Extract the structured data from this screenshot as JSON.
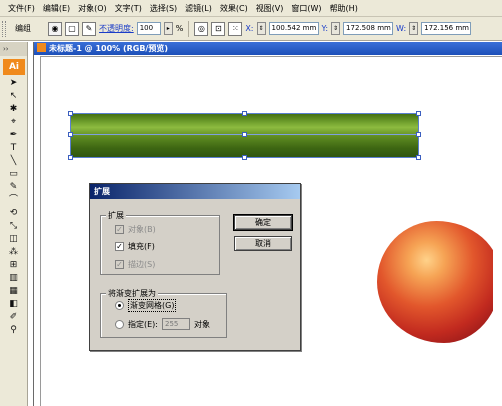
{
  "menu": [
    "文件(F)",
    "编辑(E)",
    "对象(O)",
    "文字(T)",
    "选择(S)",
    "滤镜(L)",
    "效果(C)",
    "视图(V)",
    "窗口(W)",
    "帮助(H)"
  ],
  "controlbar": {
    "selection_label": "编组",
    "opacity_label": "不透明度:",
    "opacity_value": "100",
    "opacity_unit": "%",
    "x_label": "X:",
    "x_value": "100.542 mm",
    "y_label": "Y:",
    "y_value": "172.508 mm",
    "w_label": "W:",
    "w_value": "172.156 mm"
  },
  "toolbar": {
    "header": "››",
    "logo": "Ai",
    "tools": [
      "➤",
      "↖",
      "✱",
      "⌖",
      "✒",
      "T",
      "╲",
      "▭",
      "✎",
      "⌒",
      "⟲",
      "⤡",
      "◫",
      "⁂",
      "⊞",
      "▥",
      "▦",
      "◧",
      "✐",
      "⚲"
    ]
  },
  "document": {
    "title": "未标题-1 @ 100% (RGB/预览)"
  },
  "dialog": {
    "title": "扩展",
    "expand_group_label": "扩展",
    "object_label": "对象(B)",
    "fill_label": "填充(F)",
    "stroke_label": "描边(S)",
    "gradient_group_label": "将渐变扩展为",
    "gradient_mesh_label": "渐变网格(G)",
    "specify_label": "指定(E):",
    "specify_value": "255",
    "specify_unit": "对象",
    "ok_label": "确定",
    "cancel_label": "取消"
  }
}
